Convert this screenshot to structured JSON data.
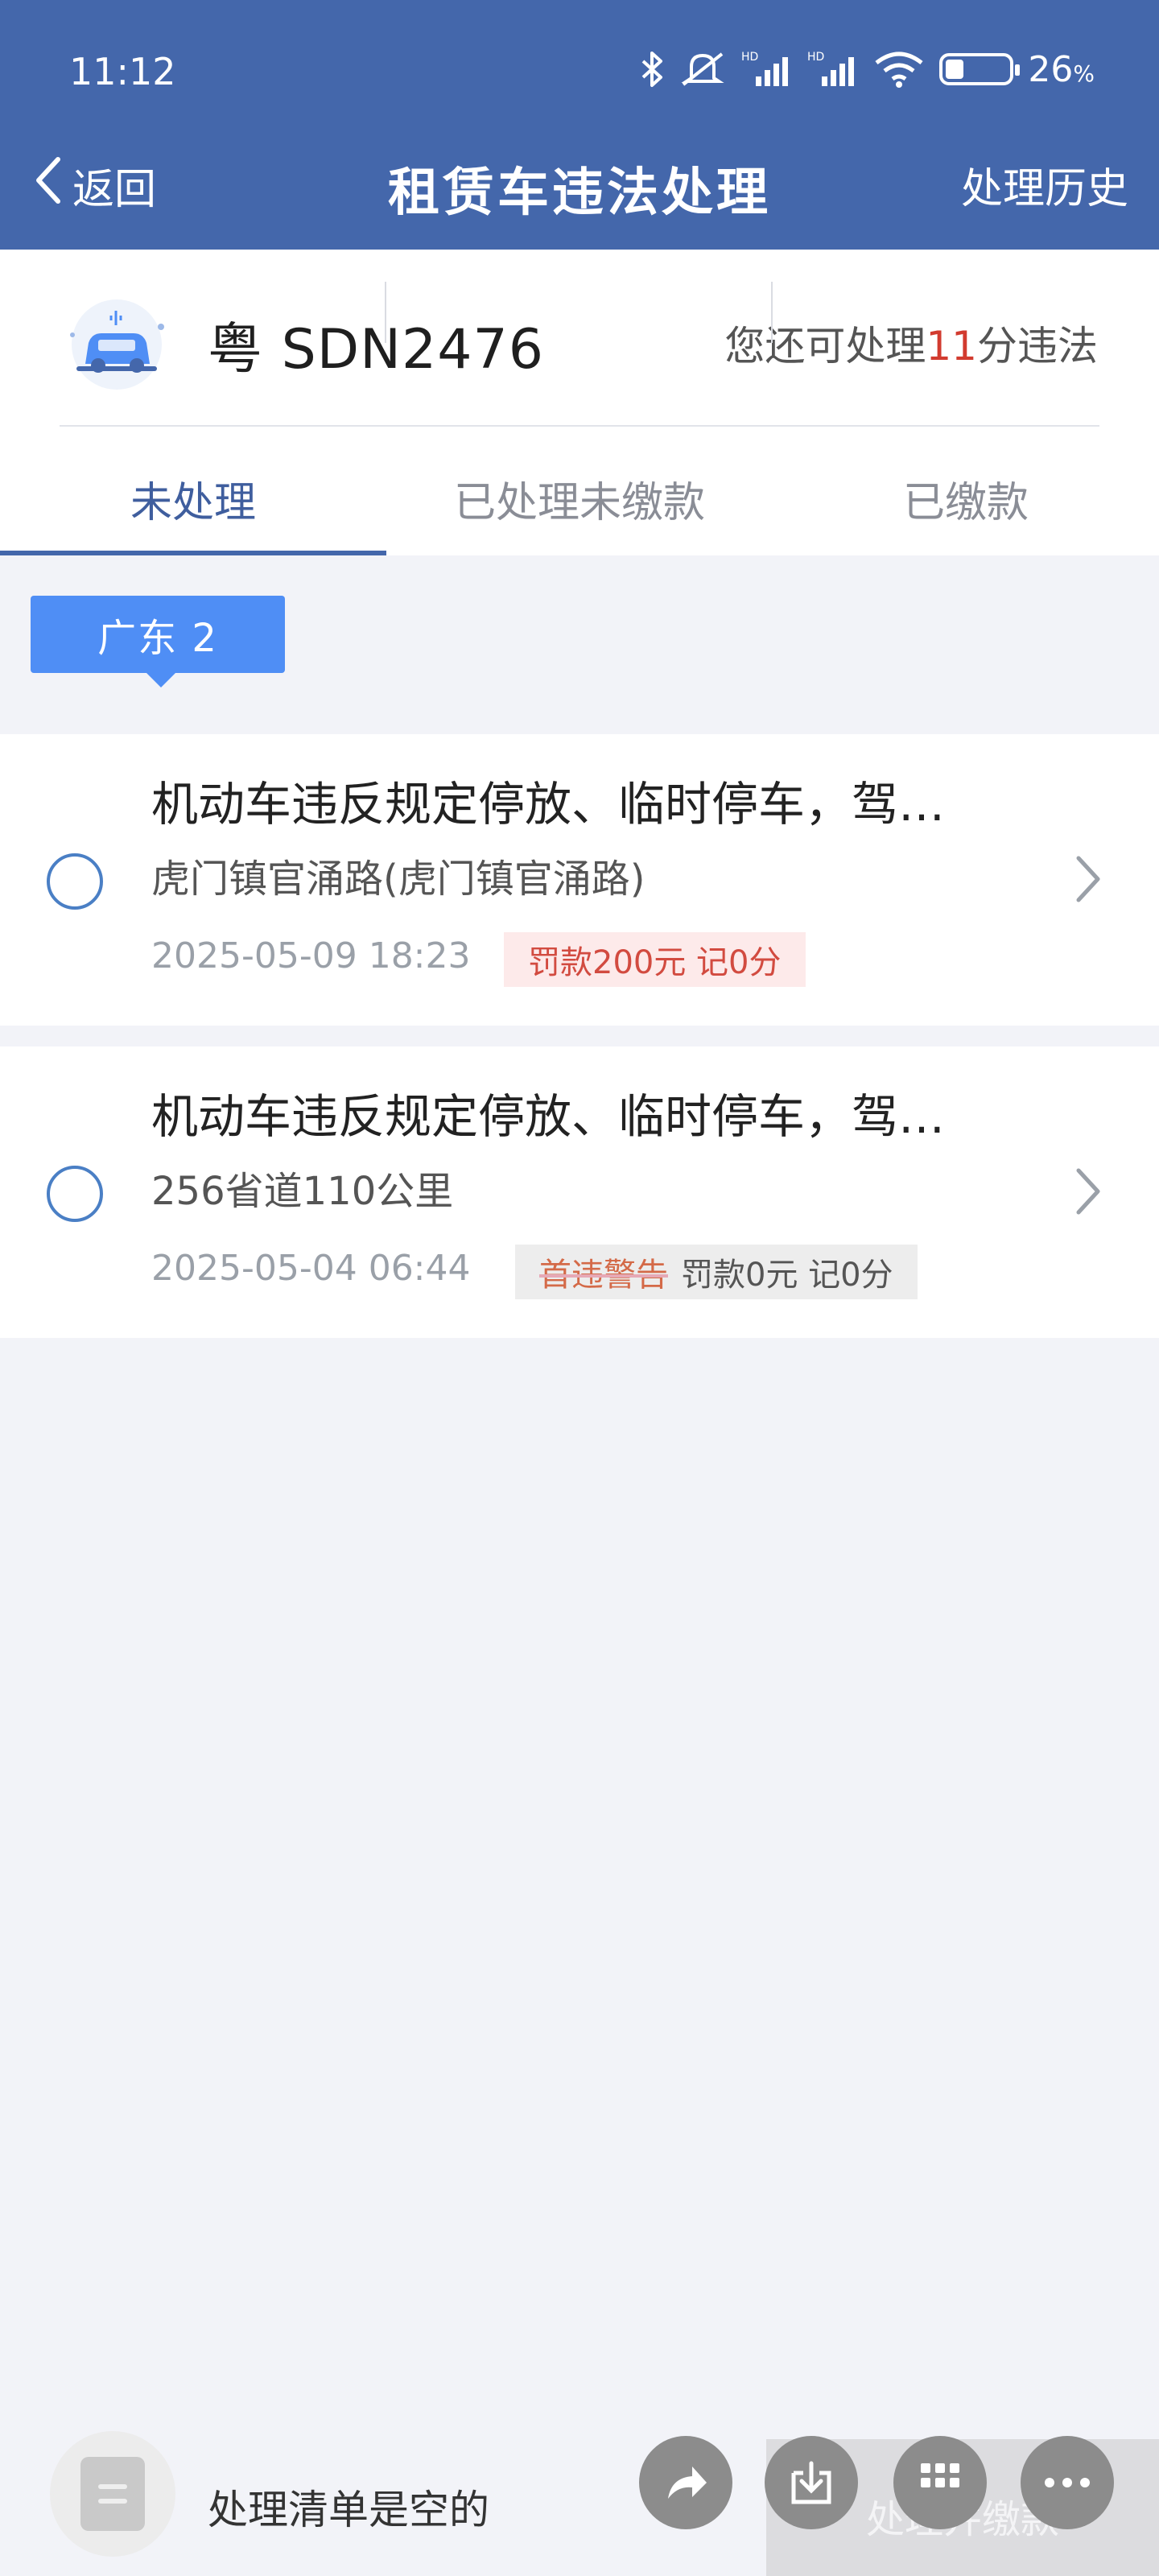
{
  "status_bar": {
    "time": "11:12",
    "battery_text": "26",
    "battery_unit": "%",
    "battery_level": 0.26,
    "icons": [
      "bluetooth-icon",
      "mute-icon",
      "hd-signal-icon",
      "hd-signal-icon",
      "wifi-icon",
      "battery-icon"
    ]
  },
  "nav": {
    "back_label": "返回",
    "title": "租赁车违法处理",
    "history_label": "处理历史"
  },
  "vehicle": {
    "plate": "粤 SDN2476",
    "remain_prefix": "您还可处理",
    "remain_count": "11",
    "remain_suffix": "分违法"
  },
  "tabs": [
    {
      "label": "未处理",
      "active": true
    },
    {
      "label": "已处理未缴款",
      "active": false
    },
    {
      "label": "已缴款",
      "active": false
    }
  ],
  "region_chip": "广东 2",
  "violations": [
    {
      "title": "机动车违反规定停放、临时停车，驾…",
      "location": "虎门镇官涌路(虎门镇官涌路)",
      "time": "2025-05-09 18:23",
      "tag": "罚款200元 记0分"
    },
    {
      "title": "机动车违反规定停放、临时停车，驾…",
      "location": "256省道110公里",
      "time": "2025-05-04 06:44",
      "warning": "首违警告",
      "tag": "罚款0元 记0分"
    }
  ],
  "bottom": {
    "empty_text": "处理清单是空的",
    "pay_button": "处理并缴款",
    "fab_icons": [
      "share-icon",
      "download-icon",
      "grid-icon",
      "more-icon"
    ]
  },
  "colors": {
    "header": "#4467ab",
    "accent": "#4f8ef5",
    "highlight_red": "#d23b2f"
  }
}
